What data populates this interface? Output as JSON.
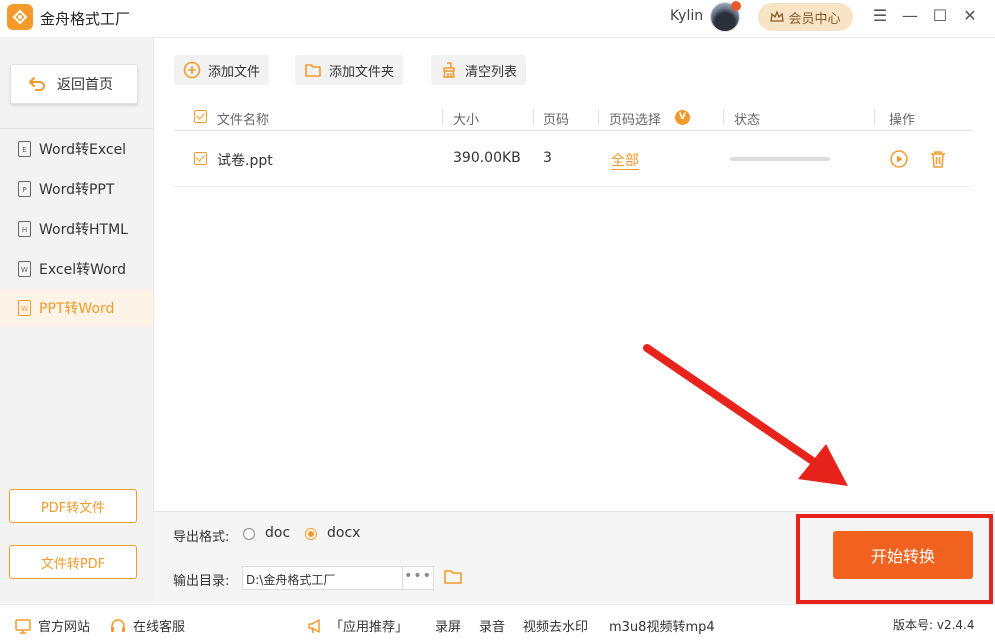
{
  "app": {
    "title": "金舟格式工厂",
    "username": "Kylin",
    "vip_label": "会员中心"
  },
  "window": {
    "menu": "☰",
    "minimize": "—",
    "maximize": "☐",
    "close": "✕"
  },
  "sidebar": {
    "back_label": "返回首页",
    "items": [
      {
        "label": "Word转Excel",
        "icon_letter": "E"
      },
      {
        "label": "Word转PPT",
        "icon_letter": "P"
      },
      {
        "label": "Word转HTML",
        "icon_letter": "H"
      },
      {
        "label": "Excel转Word",
        "icon_letter": "W"
      },
      {
        "label": "PPT转Word",
        "icon_letter": "W"
      }
    ],
    "pdf_to_file": "PDF转文件",
    "file_to_pdf": "文件转PDF"
  },
  "toolbar": {
    "add_file": "添加文件",
    "add_folder": "添加文件夹",
    "clear_list": "清空列表"
  },
  "table": {
    "headers": {
      "name": "文件名称",
      "size": "大小",
      "pages": "页码",
      "page_select": "页码选择",
      "status": "状态",
      "actions": "操作"
    },
    "page_select_badge": "V",
    "rows": [
      {
        "name": "试卷.ppt",
        "size": "390.00KB",
        "pages": "3",
        "page_select": "全部",
        "progress": 0
      }
    ]
  },
  "bottom": {
    "format_label": "导出格式:",
    "format_options": [
      "doc",
      "docx"
    ],
    "format_selected": "docx",
    "output_label": "输出目录:",
    "output_path": "D:\\金舟格式工厂",
    "more": "•••",
    "start_label": "开始转换"
  },
  "statusbar": {
    "website": "官方网站",
    "support": "在线客服",
    "recommend": "「应用推荐」",
    "links": [
      "录屏",
      "录音",
      "视频去水印",
      "m3u8视频转mp4"
    ],
    "version": "版本号: v2.4.4"
  },
  "colors": {
    "accent": "#f39a2b",
    "start_button": "#f2621f",
    "highlight_frame": "#e8231b",
    "arrow": "#e8231b"
  }
}
